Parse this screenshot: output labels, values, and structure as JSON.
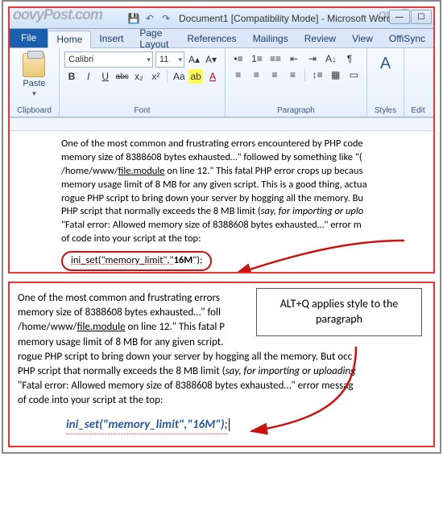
{
  "window": {
    "watermark": "oovyPost.com",
    "watermark2": "ovyP",
    "title": "Document1 [Compatibility Mode] - Microsoft Word",
    "qat": {
      "save": "💾",
      "undo": "↶",
      "redo": "↷"
    },
    "tabs": [
      "File",
      "Home",
      "Insert",
      "Page Layout",
      "References",
      "Mailings",
      "Review",
      "View",
      "OffiSync"
    ],
    "active_tab": "Home"
  },
  "ribbon": {
    "clipboard": {
      "paste": "Paste",
      "label": "Clipboard"
    },
    "font": {
      "family": "Calibri",
      "size": "11",
      "label": "Font",
      "bold": "B",
      "italic": "I",
      "underline": "U",
      "strike": "abc",
      "sub": "x₂",
      "sup": "x²",
      "grow": "A▴",
      "shrink": "A▾",
      "case": "Aa",
      "clear": "⌫",
      "color": "A",
      "highlight": "ab"
    },
    "paragraph": {
      "label": "Paragraph",
      "bullets": "•≡",
      "numbers": "1≡",
      "multilevel": "≡≡",
      "indent_dec": "⇤",
      "indent_inc": "⇥",
      "sort": "A↓",
      "marks": "¶",
      "left": "≡",
      "center": "≡",
      "right": "≡",
      "justify": "≡",
      "spacing": "↕≡",
      "shading": "▦",
      "border": "▭"
    },
    "styles": {
      "label": "Styles",
      "icon": "A"
    },
    "editing": {
      "label": "Edit"
    }
  },
  "doc": {
    "para1": "One of the most common and frustrating errors encountered by PHP code",
    "para2a": "memory size of 8388608 bytes exhausted…\" followed by something like \"(",
    "para2b": "/home/www/",
    "para2c": "file.module",
    "para2d": "  on line 12.\" This fatal PHP error crops up becaus",
    "para3": "memory usage limit of 8 MB for any given script. This is a good thing, actua",
    "para4": "rogue PHP script to bring down your server by hogging all the memory. Bu",
    "para5a": "PHP script that normally exceeds the 8 MB limit (",
    "para5b": "say, for importing or uplo",
    "para6": "\"Fatal error: Allowed memory size of 8388608 bytes exhausted…\"  error m",
    "para7": "of code into your script at the top:",
    "code_a": "ini_set(\"memory_limit\",\"",
    "code_b": "16M",
    "code_c": "\");"
  },
  "panel2": {
    "para1": "One of the most common and frustrating errors",
    "para2": "memory size of 8388608 bytes exhausted…\"  foll",
    "para3a": "/home/www/",
    "para3b": "file.module",
    "para3c": "  on line 12.\" This fatal P",
    "para4": "memory usage limit of 8 MB for any given script.",
    "para5": "rogue PHP script to bring down your server by hogging all the memory. But occ",
    "para6a": "PHP script that normally exceeds the 8 MB limit (",
    "para6b": "say, for importing or uploading",
    "para7": "\"Fatal error: Allowed memory size of 8388608 bytes exhausted…\"  error messag",
    "para8": "of code into your script at the top:",
    "code": "ini_set(\"memory_limit\",\"16M\");",
    "callout": "ALT+Q applies style to the paragraph"
  }
}
